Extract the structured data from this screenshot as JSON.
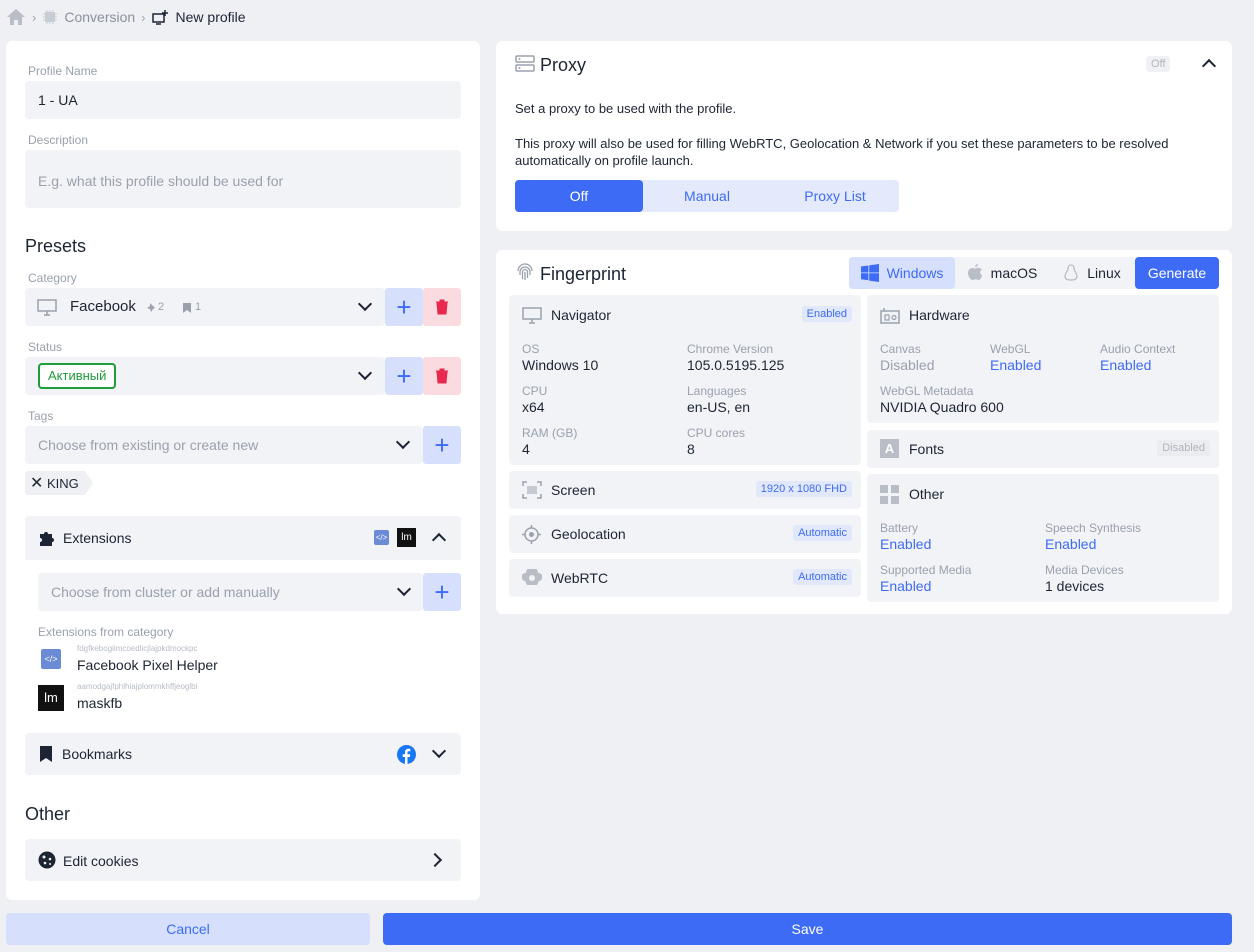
{
  "breadcrumb": {
    "conversion": "Conversion",
    "new_profile": "New profile"
  },
  "left": {
    "profile_name_label": "Profile Name",
    "profile_name_value": "1 - UA",
    "description_label": "Description",
    "description_placeholder": "E.g. what this profile should be used for",
    "presets_title": "Presets",
    "category_label": "Category",
    "category_value": "Facebook",
    "category_pins": "2",
    "category_bookmarks": "1",
    "status_label": "Status",
    "status_value": "Активный",
    "tags_label": "Tags",
    "tags_placeholder": "Choose from existing or create new",
    "tag_chip": "KING",
    "extensions_title": "Extensions",
    "extensions_placeholder": "Choose from cluster or add manually",
    "extensions_from_category": "Extensions from category",
    "ext_items": [
      {
        "id": "fdgfkebogiimcoedlicjlajpkdmockpc",
        "name": "Facebook Pixel Helper"
      },
      {
        "id": "aamodgajfphlhiajplommkhffjeoglbi",
        "name": "maskfb"
      }
    ],
    "bookmarks_title": "Bookmarks",
    "other_title": "Other",
    "edit_cookies": "Edit cookies"
  },
  "proxy": {
    "title": "Proxy",
    "state_badge": "Off",
    "desc1": "Set a proxy to be used with the profile.",
    "desc2": "This proxy will also be used for filling WebRTC, Geolocation & Network if you set these parameters to be resolved automatically on profile launch.",
    "tabs": [
      "Off",
      "Manual",
      "Proxy List"
    ]
  },
  "fingerprint": {
    "title": "Fingerprint",
    "os_tabs": [
      "Windows",
      "macOS",
      "Linux"
    ],
    "generate": "Generate",
    "navigator": {
      "title": "Navigator",
      "badge": "Enabled",
      "os_l": "OS",
      "os_v": "Windows 10",
      "chrome_l": "Chrome Version",
      "chrome_v": "105.0.5195.125",
      "cpu_l": "CPU",
      "cpu_v": "x64",
      "lang_l": "Languages",
      "lang_v": "en-US, en",
      "ram_l": "RAM (GB)",
      "ram_v": "4",
      "cores_l": "CPU cores",
      "cores_v": "8"
    },
    "screen": {
      "title": "Screen",
      "badge": "1920 x 1080 FHD"
    },
    "geolocation": {
      "title": "Geolocation",
      "badge": "Automatic"
    },
    "webrtc": {
      "title": "WebRTC",
      "badge": "Automatic"
    },
    "hardware": {
      "title": "Hardware",
      "canvas_l": "Canvas",
      "canvas_v": "Disabled",
      "webgl_l": "WebGL",
      "webgl_v": "Enabled",
      "audio_l": "Audio Context",
      "audio_v": "Enabled",
      "meta_l": "WebGL Metadata",
      "meta_v": "NVIDIA Quadro 600"
    },
    "fonts": {
      "title": "Fonts",
      "badge": "Disabled"
    },
    "other": {
      "title": "Other",
      "battery_l": "Battery",
      "battery_v": "Enabled",
      "speech_l": "Speech Synthesis",
      "speech_v": "Enabled",
      "media_l": "Supported Media",
      "media_v": "Enabled",
      "devices_l": "Media Devices",
      "devices_v": "1 devices"
    }
  },
  "footer": {
    "cancel": "Cancel",
    "save": "Save"
  },
  "colors": {
    "accent": "#3d6bf5",
    "danger": "#e8284f",
    "status_green": "#1f9d3a"
  }
}
